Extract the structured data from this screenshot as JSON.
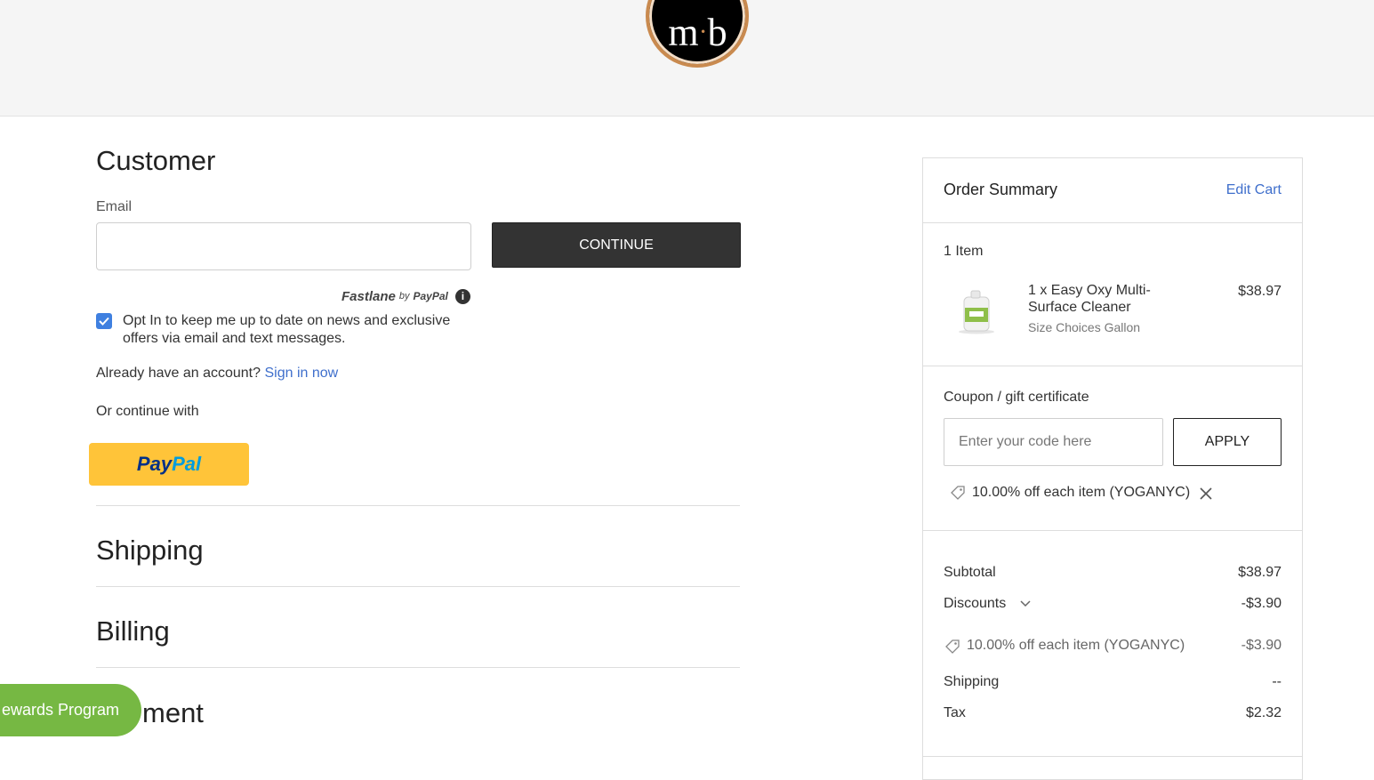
{
  "logo": {
    "text_left": "m",
    "text_dot": "·",
    "text_right": "b"
  },
  "customer": {
    "heading": "Customer",
    "email_label": "Email",
    "email_value": "",
    "continue_label": "CONTINUE",
    "fastlane": {
      "name": "Fastlane",
      "by": "by",
      "brand": "PayPal",
      "info_glyph": "i"
    },
    "optin_checked": true,
    "optin_text": "Opt In to keep me up to date on news and exclusive offers via email and text messages.",
    "account_prompt": "Already have an account?",
    "sign_in_label": "Sign in now",
    "continue_with": "Or continue with",
    "paypal": {
      "part1": "Pay",
      "part2": "Pal"
    }
  },
  "sections": {
    "shipping": "Shipping",
    "billing": "Billing",
    "payment": "ment"
  },
  "rewards": {
    "label": "ewards Program"
  },
  "summary": {
    "title": "Order Summary",
    "edit_cart": "Edit Cart",
    "item_count": "1 Item",
    "product": {
      "name_line1": "1 x Easy Oxy Multi-",
      "name_line2": "Surface Cleaner",
      "option": "Size Choices Gallon",
      "price": "$38.97"
    },
    "coupon": {
      "label": "Coupon / gift certificate",
      "placeholder": "Enter your code here",
      "apply_label": "APPLY",
      "applied": "10.00% off each item (YOGANYC)"
    },
    "totals": {
      "subtotal_label": "Subtotal",
      "subtotal_value": "$38.97",
      "discounts_label": "Discounts",
      "discounts_value": "-$3.90",
      "discount_detail_label": "10.00% off each item (YOGANYC)",
      "discount_detail_value": "-$3.90",
      "shipping_label": "Shipping",
      "shipping_value": "--",
      "tax_label": "Tax",
      "tax_value": "$2.32"
    }
  },
  "colors": {
    "link": "#3f6fcc",
    "continue_bg": "#333333",
    "paypal_bg": "#ffc439",
    "rewards_bg": "#76b843",
    "checkbox": "#3f80e0"
  },
  "icons": [
    "info-icon",
    "checkbox-check-icon",
    "tag-icon",
    "close-icon",
    "chevron-down-icon",
    "product-bottle-icon"
  ]
}
